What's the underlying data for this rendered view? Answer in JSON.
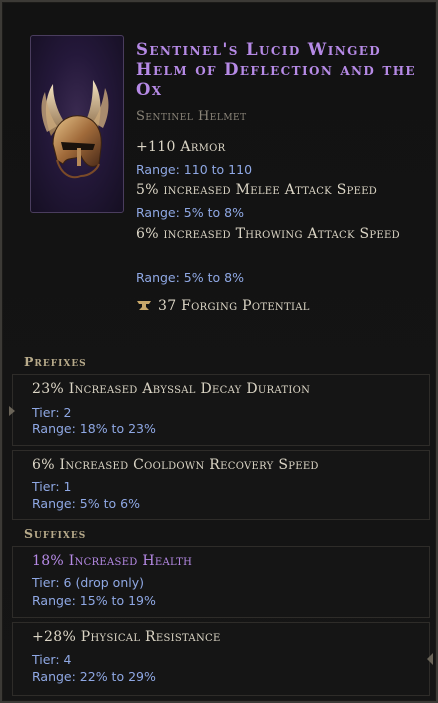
{
  "item": {
    "name": "Sentinel's Lucid Winged Helm of Deflection and the Ox",
    "base_type": "Sentinel Helmet",
    "icon": "winged-helmet-icon",
    "name_color": "#b68ae6"
  },
  "implicit": {
    "armor_text": "+110 Armor",
    "armor_range": "Range: 110 to 110",
    "melee_text": "5% increased Melee Attack Speed",
    "melee_range": "Range: 5% to 8%",
    "throw_text": "6% increased Throwing Attack Speed",
    "throw_range": "Range: 5% to 8%"
  },
  "forging": {
    "icon": "anvil-icon",
    "text": "37 Forging Potential"
  },
  "prefixes": {
    "header": "Prefixes",
    "items": [
      {
        "name": "23% Increased Abyssal Decay Duration",
        "tier": "Tier: 2",
        "range": "Range: 18% to 23%"
      },
      {
        "name": "6% Increased Cooldown Recovery Speed",
        "tier": "Tier: 1",
        "range": "Range: 5% to 6%"
      }
    ]
  },
  "suffixes": {
    "header": "Suffixes",
    "items": [
      {
        "name": "18% Increased Health",
        "tier": "Tier: 6 (drop only)",
        "range": "Range: 15% to 19%"
      },
      {
        "name": "+28% Physical Resistance",
        "tier": "Tier: 4",
        "range": "Range: 22% to 29%"
      }
    ]
  },
  "colors": {
    "stat_text": "#dcd6c6",
    "range_text": "#8fa8e4",
    "exalted_affix": "#b68ae6",
    "header_gold": "#b7aa8a"
  }
}
